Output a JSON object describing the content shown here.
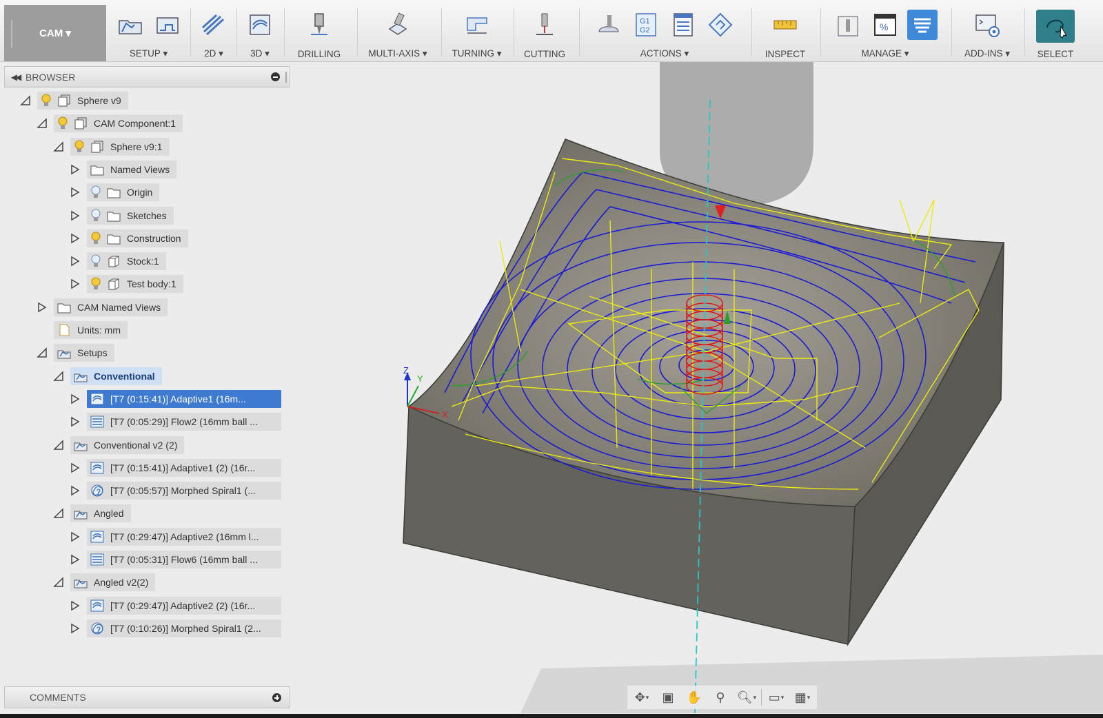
{
  "workspace": {
    "label": "CAM ▾"
  },
  "toolbar": {
    "groups": [
      {
        "label": "SETUP ▾",
        "icons": [
          "setup-folder-icon",
          "setup-sheet-icon"
        ]
      },
      {
        "label": "2D ▾",
        "icons": [
          "2d-pocket-icon"
        ]
      },
      {
        "label": "3D ▾",
        "icons": [
          "3d-adaptive-icon"
        ]
      },
      {
        "label": "DRILLING",
        "icons": [
          "drill-icon"
        ]
      },
      {
        "label": "MULTI-AXIS ▾",
        "icons": [
          "multi-axis-icon"
        ]
      },
      {
        "label": "TURNING ▾",
        "icons": [
          "turning-icon"
        ]
      },
      {
        "label": "CUTTING",
        "icons": [
          "cutting-icon"
        ]
      },
      {
        "label": "ACTIONS ▾",
        "icons": [
          "simulate-icon",
          "post-process-icon",
          "setup-sheet-actions-icon",
          "generate-icon"
        ]
      },
      {
        "label": "INSPECT",
        "icons": [
          "measure-icon"
        ]
      },
      {
        "label": "MANAGE ▾",
        "icons": [
          "tool-library-icon",
          "template-icon",
          "post-library-icon"
        ]
      },
      {
        "label": "ADD-INS ▾",
        "icons": [
          "scripts-addins-icon"
        ]
      },
      {
        "label": "SELECT",
        "icons": [
          "select-icon"
        ]
      }
    ]
  },
  "browser": {
    "title": "BROWSER",
    "items": [
      {
        "label": "Sphere v9",
        "indent": 0,
        "expanded": true,
        "bulb": "yellow",
        "icon": "component"
      },
      {
        "label": "CAM Component:1",
        "indent": 1,
        "expanded": true,
        "bulb": "yellow",
        "icon": "component"
      },
      {
        "label": "Sphere v9:1",
        "indent": 2,
        "expanded": true,
        "bulb": "yellow",
        "icon": "component"
      },
      {
        "label": "Named Views",
        "indent": 3,
        "expanded": false,
        "bulb": "none",
        "icon": "folder"
      },
      {
        "label": "Origin",
        "indent": 3,
        "expanded": false,
        "bulb": "blue",
        "icon": "folder"
      },
      {
        "label": "Sketches",
        "indent": 3,
        "expanded": false,
        "bulb": "blue",
        "icon": "folder"
      },
      {
        "label": "Construction",
        "indent": 3,
        "expanded": false,
        "bulb": "yellow",
        "icon": "folder"
      },
      {
        "label": "Stock:1",
        "indent": 3,
        "expanded": false,
        "bulb": "blue",
        "icon": "body"
      },
      {
        "label": "Test body:1",
        "indent": 3,
        "expanded": false,
        "bulb": "yellow",
        "icon": "body"
      },
      {
        "label": "CAM Named Views",
        "indent": 1,
        "expanded": false,
        "bulb": "none",
        "icon": "folder"
      },
      {
        "label": "Units: mm",
        "indent": 1,
        "expanded": null,
        "bulb": "none",
        "icon": "doc"
      },
      {
        "label": "Setups",
        "indent": 1,
        "expanded": true,
        "bulb": "none",
        "icon": "setup"
      },
      {
        "label": "Conventional",
        "indent": 2,
        "expanded": true,
        "bulb": "none",
        "icon": "setup",
        "state": "active"
      },
      {
        "label": "[T7 (0:15:41)] Adaptive1 (16m...",
        "indent": 3,
        "expanded": false,
        "bulb": "none",
        "icon": "op-adaptive",
        "state": "selected"
      },
      {
        "label": "[T7 (0:05:29)] Flow2 (16mm ball ...",
        "indent": 3,
        "expanded": false,
        "bulb": "none",
        "icon": "op-flow"
      },
      {
        "label": "Conventional v2 (2)",
        "indent": 2,
        "expanded": true,
        "bulb": "none",
        "icon": "setup"
      },
      {
        "label": "[T7 (0:15:41)] Adaptive1 (2) (16r...",
        "indent": 3,
        "expanded": false,
        "bulb": "none",
        "icon": "op-adaptive"
      },
      {
        "label": "[T7 (0:05:57)] Morphed Spiral1 (...",
        "indent": 3,
        "expanded": false,
        "bulb": "none",
        "icon": "op-spiral"
      },
      {
        "label": "Angled",
        "indent": 2,
        "expanded": true,
        "bulb": "none",
        "icon": "setup"
      },
      {
        "label": "[T7 (0:29:47)] Adaptive2 (16mm l...",
        "indent": 3,
        "expanded": false,
        "bulb": "none",
        "icon": "op-adaptive"
      },
      {
        "label": "[T7 (0:05:31)] Flow6 (16mm ball ...",
        "indent": 3,
        "expanded": false,
        "bulb": "none",
        "icon": "op-flow"
      },
      {
        "label": "Angled v2(2)",
        "indent": 2,
        "expanded": true,
        "bulb": "none",
        "icon": "setup"
      },
      {
        "label": "[T7 (0:29:47)] Adaptive2 (2) (16r...",
        "indent": 3,
        "expanded": false,
        "bulb": "none",
        "icon": "op-adaptive"
      },
      {
        "label": "[T7 (0:10:26)] Morphed Spiral1 (2...",
        "indent": 3,
        "expanded": false,
        "bulb": "none",
        "icon": "op-spiral"
      }
    ]
  },
  "comments": {
    "title": "COMMENTS"
  },
  "viewport": {
    "axis_labels": {
      "x": "X",
      "y": "Y",
      "z": "Z"
    },
    "colors": {
      "toolpath_feed": "#1a1ad6",
      "toolpath_rapid": "#f0f000",
      "toolpath_plunge": "#e01010",
      "leads": "#2aa02a",
      "model": "#6d6b65",
      "tool": "#a8a8a8"
    }
  },
  "navbar": {
    "icons": [
      "orbit-icon",
      "look-at-icon",
      "pan-icon",
      "zoom-icon",
      "zoom-window-icon",
      "display-settings-icon",
      "grid-icon"
    ]
  }
}
